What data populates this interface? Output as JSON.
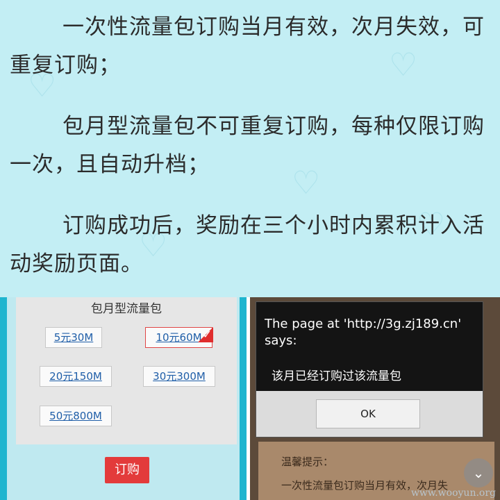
{
  "rules": {
    "p1": "一次性流量包订购当月有效，次月失效，可重复订购；",
    "p2": "包月型流量包不可重复订购，每种仅限订购一次，且自动升档；",
    "p3": "订购成功后，奖励在三个小时内累积计入活动奖励页面。"
  },
  "packages": {
    "title": "包月型流量包",
    "items": [
      {
        "label": "5元30M",
        "selected": false
      },
      {
        "label": "10元60M",
        "selected": true
      },
      {
        "label": "20元150M",
        "selected": false
      },
      {
        "label": "30元300M",
        "selected": false
      },
      {
        "label": "50元800M",
        "selected": false
      }
    ],
    "order_label": "订购"
  },
  "dialog": {
    "title": "The page at 'http://3g.zj189.cn' says:",
    "message": "该月已经订购过该流量包",
    "ok_label": "OK"
  },
  "background_page": {
    "hint_title": "温馨提示：",
    "hint_text": "一次性流量包订购当月有效，次月失"
  },
  "watermark": "www.wooyun.org",
  "colors": {
    "accent_red": "#e33b3b",
    "teal_bg": "#c3eef4",
    "link_blue": "#1f5ea8"
  }
}
